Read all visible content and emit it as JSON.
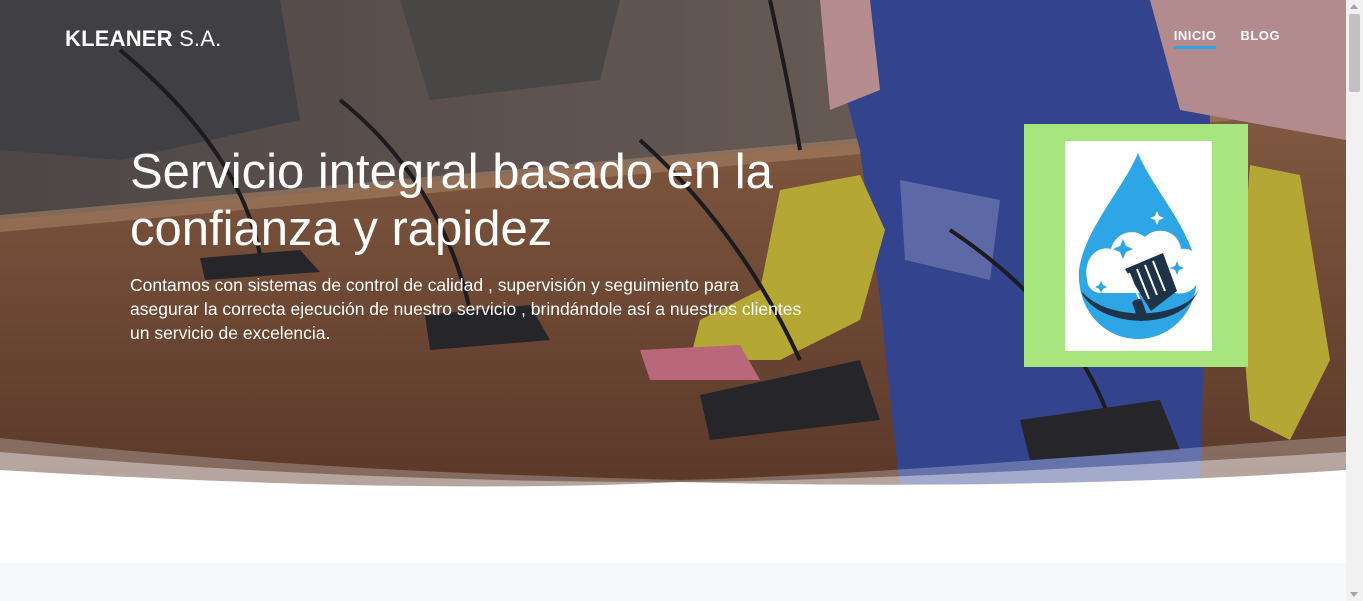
{
  "brand": {
    "strong": "KLEANER",
    "light": "S.A."
  },
  "nav": {
    "items": [
      {
        "label": "INICIO",
        "active": true
      },
      {
        "label": "BLOG",
        "active": false
      }
    ]
  },
  "hero": {
    "title": "Servicio integral basado en la confianza y rapidez",
    "text": "Contamos con sistemas de control de calidad , supervisión y seguimiento para asegurar la correcta ejecución de nuestro servicio , brindándole así a nuestros clientes un servicio de excelencia.",
    "logo": {
      "icon": "water-drop-broom-logo-icon",
      "frame_color": "#a8e57e",
      "drop_color": "#2ea6e6",
      "dark_color": "#1f3348"
    }
  },
  "colors": {
    "accent": "#2ea6e6",
    "section_light_bg": "#f5f9fb"
  }
}
